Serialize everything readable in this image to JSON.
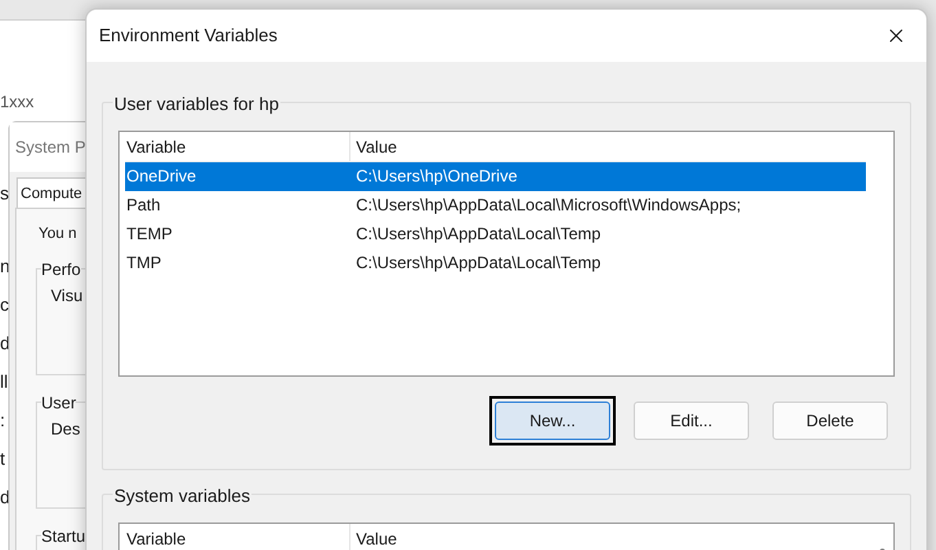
{
  "back_window": {
    "label": "1xxx",
    "top_text": "s",
    "side_texts": [
      "n",
      "c",
      "d",
      "ll",
      ":",
      "t",
      "d"
    ]
  },
  "system_window": {
    "title": "System P",
    "tab": {
      "label": "Compute",
      "selected": true
    },
    "intro": "You n",
    "groups": [
      {
        "label": "Perfo",
        "text": "Visu"
      },
      {
        "label": "User",
        "text": "Des"
      },
      {
        "label": "Startu"
      }
    ]
  },
  "env_window": {
    "title": "Environment Variables",
    "user_group": {
      "label": "User variables for hp",
      "columns": [
        "Variable",
        "Value"
      ],
      "rows": [
        {
          "variable": "OneDrive",
          "value": "C:\\Users\\hp\\OneDrive",
          "selected": true
        },
        {
          "variable": "Path",
          "value": "C:\\Users\\hp\\AppData\\Local\\Microsoft\\WindowsApps;",
          "selected": false
        },
        {
          "variable": "TEMP",
          "value": "C:\\Users\\hp\\AppData\\Local\\Temp",
          "selected": false
        },
        {
          "variable": "TMP",
          "value": "C:\\Users\\hp\\AppData\\Local\\Temp",
          "selected": false
        }
      ],
      "buttons": [
        {
          "label": "New...",
          "focused": true
        },
        {
          "label": "Edit...",
          "focused": false
        },
        {
          "label": "Delete",
          "focused": false
        }
      ]
    },
    "system_group": {
      "label": "System variables",
      "columns": [
        "Variable",
        "Value"
      ]
    }
  }
}
